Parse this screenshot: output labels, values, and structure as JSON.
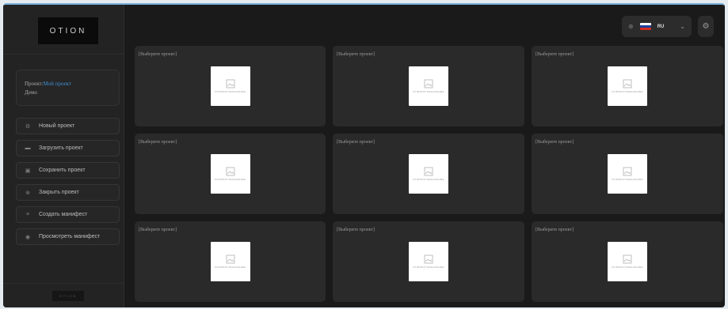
{
  "sidebar": {
    "logo": "OTION",
    "project": {
      "label": "Проект:",
      "name": "Мой проект",
      "subtitle": "Демо"
    },
    "menu": [
      {
        "label": "Новый проект",
        "icon": "plus-circle-icon"
      },
      {
        "label": "Загрузить проект",
        "icon": "folder-icon"
      },
      {
        "label": "Сохранить проект",
        "icon": "save-icon"
      },
      {
        "label": "Закрыть проект",
        "icon": "close-circle-icon"
      },
      {
        "label": "Создать манифест",
        "icon": "manifest-icon"
      },
      {
        "label": "Просмотреть манифест",
        "icon": "eye-icon"
      }
    ],
    "footer_logo": "OTION"
  },
  "topbar": {
    "lang_code": "RU",
    "flag_colors": [
      "#ffffff",
      "#1c3f9e",
      "#d52b1e"
    ]
  },
  "panels": [
    {
      "label": "[Выберите проект]",
      "placeholder_text": "NO PRODUCT IMAGE AVAILABLE"
    },
    {
      "label": "[Выберите проект]",
      "placeholder_text": "NO PRODUCT IMAGE AVAILABLE"
    },
    {
      "label": "[Выберите проект]",
      "placeholder_text": "NO PRODUCT IMAGE AVAILABLE"
    },
    {
      "label": "[Выберите проект]",
      "placeholder_text": "NO PRODUCT IMAGE AVAILABLE"
    },
    {
      "label": "[Выберите проект]",
      "placeholder_text": "NO PRODUCT IMAGE AVAILABLE"
    },
    {
      "label": "[Выберите проект]",
      "placeholder_text": "NO PRODUCT IMAGE AVAILABLE"
    },
    {
      "label": "[Выберите проект]",
      "placeholder_text": "NO PRODUCT IMAGE AVAILABLE"
    },
    {
      "label": "[Выберите проект]",
      "placeholder_text": "NO PRODUCT IMAGE AVAILABLE"
    },
    {
      "label": "[Выберите проект]",
      "placeholder_text": "NO PRODUCT IMAGE AVAILABLE"
    }
  ]
}
